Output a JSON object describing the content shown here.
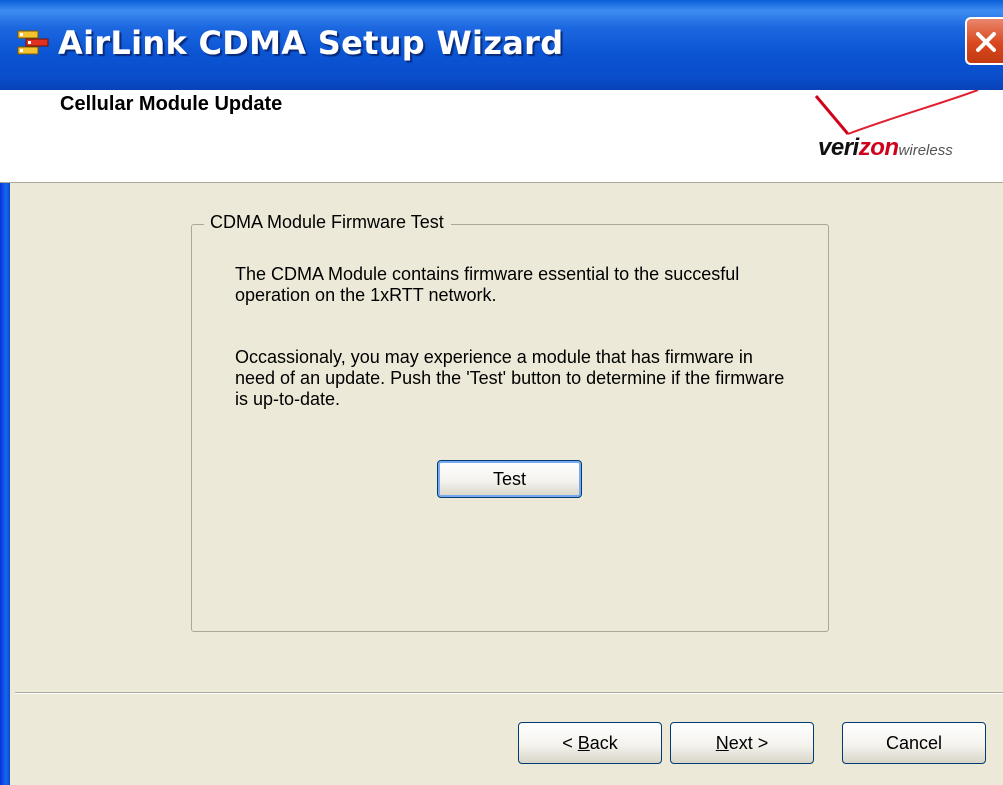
{
  "window": {
    "title": "AirLink CDMA Setup Wizard",
    "app_icon": "airlink-app-icon",
    "close_icon": "close-x-icon"
  },
  "header": {
    "title": "Cellular Module Update",
    "logo": {
      "name": "verizon-wireless-logo",
      "prefix": "veri",
      "accent": "zon",
      "suffix": "wireless",
      "accent_color": "#d0021b"
    }
  },
  "group": {
    "legend": "CDMA Module Firmware Test",
    "paragraph1": "The CDMA Module contains firmware essential to the succesful operation on the 1xRTT network.",
    "paragraph2": "Occassionaly, you may experience a module that has firmware in need of an update. Push the 'Test' button to determine if the firmware is up-to-date.",
    "test_button": "Test"
  },
  "footer": {
    "back_prefix": "< ",
    "back_mnemonic": "B",
    "back_rest": "ack",
    "next_mnemonic": "N",
    "next_rest": "ext >",
    "cancel": "Cancel"
  },
  "colors": {
    "titlebar": "#0a54d4",
    "dialog_bg": "#ece9d8",
    "close_button": "#d9481f"
  }
}
